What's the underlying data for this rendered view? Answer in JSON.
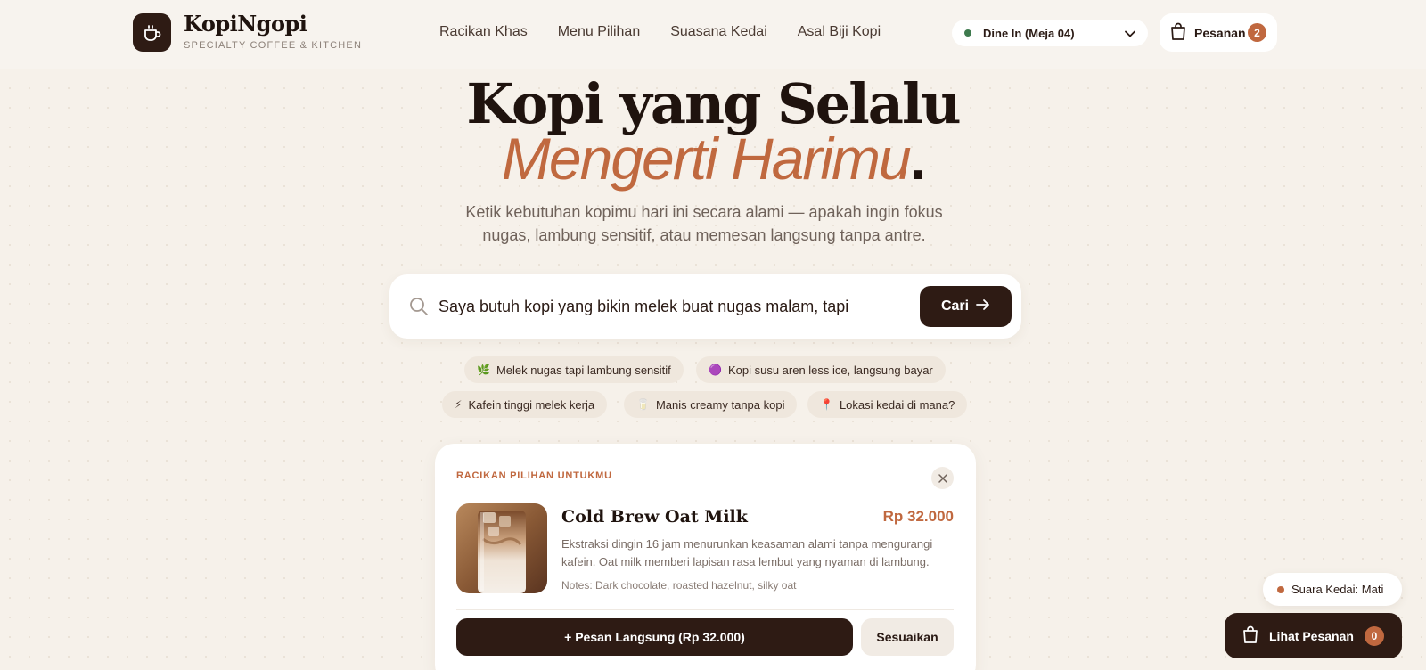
{
  "brand": {
    "name": "KopiNgopi",
    "tagline": "SPECIALTY COFFEE & KITCHEN"
  },
  "nav": {
    "items": [
      {
        "label": "Racikan Khas"
      },
      {
        "label": "Menu Pilihan"
      },
      {
        "label": "Suasana Kedai"
      },
      {
        "label": "Asal Biji Kopi"
      }
    ]
  },
  "dine": {
    "selected": "Dine In (Meja 04)",
    "status_color": "#3e7a4e"
  },
  "cart": {
    "label": "Pesanan",
    "count": "2"
  },
  "hero": {
    "title_line1": "Kopi yang Selalu",
    "title_line2": "Mengerti Harimu",
    "title_dot": ".",
    "description": "Ketik kebutuhan kopimu hari ini secara alami — apakah ingin fokus nugas, lambung sensitif, atau memesan langsung tanpa antre."
  },
  "search": {
    "value": "Saya butuh kopi yang bikin melek buat nugas malam, tapi lambung",
    "button_label": "Cari"
  },
  "chips": [
    {
      "icon": "🌿",
      "label": "Melek nugas tapi lambung sensitif"
    },
    {
      "icon": "🟣",
      "label": "Kopi susu aren less ice, langsung bayar"
    },
    {
      "icon": "⚡",
      "label": "Kafein tinggi melek kerja"
    },
    {
      "icon": "🥛",
      "label": "Manis creamy tanpa kopi"
    },
    {
      "icon": "📍",
      "label": "Lokasi kedai di mana?"
    }
  ],
  "recommendation": {
    "kicker": "RACIKAN PILIHAN UNTUKMU",
    "name": "Cold Brew Oat Milk",
    "price": "Rp 32.000",
    "description": "Ekstraksi dingin 16 jam menurunkan keasaman alami tanpa mengurangi kafein. Oat milk memberi lapisan rasa lembut yang nyaman di lambung.",
    "notes": "Notes: Dark chocolate, roasted hazelnut, silky oat",
    "order_label": "+ Pesan Langsung (Rp 32.000)",
    "customize_label": "Sesuaikan"
  },
  "floating": {
    "sound_label": "Suara Kedai: Mati",
    "view_orders_label": "Lihat Pesanan",
    "view_orders_count": "0"
  },
  "colors": {
    "accent": "#c0683f",
    "dark": "#2e1b14",
    "background": "#f6f1ea"
  }
}
